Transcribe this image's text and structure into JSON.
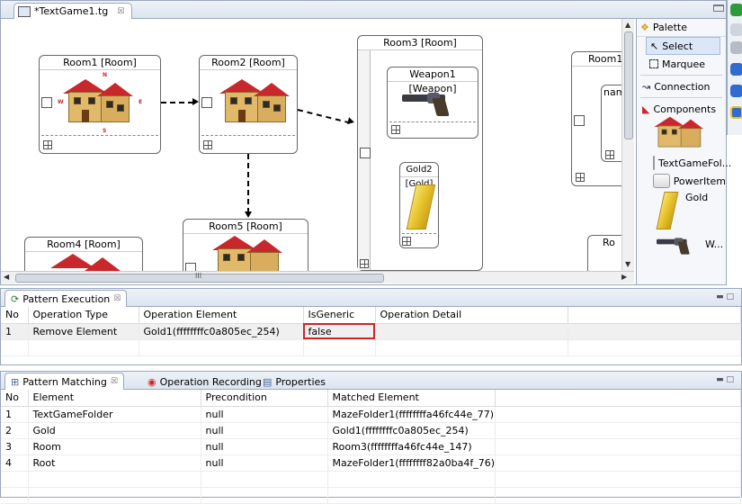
{
  "editor": {
    "tab_label": "*TextGame1.tg",
    "tab_close": "☒"
  },
  "canvas": {
    "nodes": {
      "room1": "Room1 [Room]",
      "room2": "Room2 [Room]",
      "room3": "Room3 [Room]",
      "room4": "Room4 [Room]",
      "room5": "Room5 [Room]",
      "room1_partial": "Room1",
      "weapon1": "Weapon1 [Weapon]",
      "gold2": "Gold2 [Gold]",
      "partial_nam": "nam",
      "partial_ro": "Ro"
    }
  },
  "palette": {
    "title": "Palette",
    "select": "Select",
    "marquee": "Marquee",
    "connection": "Connection",
    "components": "Components",
    "text_game_folder": "TextGameFol...",
    "power_item": "PowerItem",
    "gold": "Gold",
    "weapon_partial": "W..."
  },
  "pattern_execution": {
    "tab_label": "Pattern Execution",
    "columns": [
      "No",
      "Operation Type",
      "Operation Element",
      "IsGeneric",
      "Operation Detail"
    ],
    "rows": [
      [
        "1",
        "Remove Element",
        "Gold1(ffffffffc0a805ec_254)",
        "false",
        ""
      ]
    ]
  },
  "pattern_matching": {
    "tabs": [
      "Pattern Matching",
      "Operation Recording",
      "Properties"
    ],
    "columns": [
      "No",
      "Element",
      "Precondition",
      "Matched Element"
    ],
    "rows": [
      [
        "1",
        "TextGameFolder",
        "null",
        "MazeFolder1(ffffffffa46fc44e_77)"
      ],
      [
        "2",
        "Gold",
        "null",
        "Gold1(ffffffffc0a805ec_254)"
      ],
      [
        "3",
        "Room",
        "null",
        "Room3(ffffffffa46fc44e_147)"
      ],
      [
        "4",
        "Root",
        "null",
        "MazeFolder1(ffffffff82a0ba4f_76)"
      ]
    ]
  },
  "scroll_grip": "III",
  "colors": {
    "highlight": "#c8282c",
    "roof": "#c8282c",
    "wall": "#e0b96a"
  }
}
